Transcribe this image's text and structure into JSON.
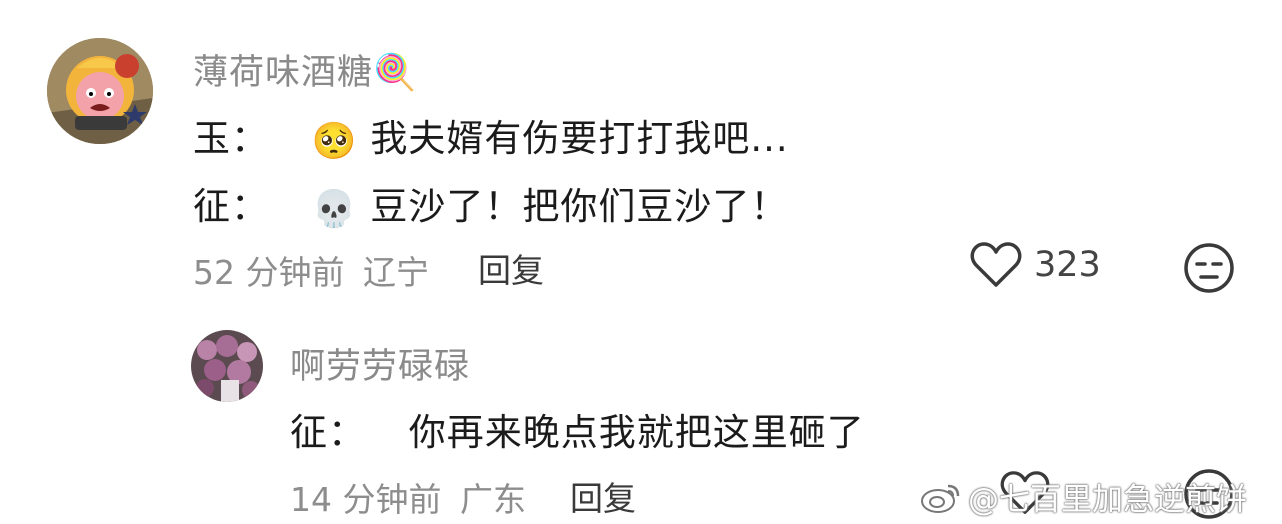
{
  "comments": [
    {
      "username": "薄荷味酒糖🍭",
      "lines": [
        {
          "speaker": "玉：",
          "emoji": "🥺",
          "text": "我夫婿有伤要打打我吧..."
        },
        {
          "speaker": "征：",
          "emoji": "💀",
          "text": "豆沙了！把你们豆沙了！"
        }
      ],
      "time": "52 分钟前",
      "location": "辽宁",
      "reply_label": "回复",
      "like_count": "323"
    },
    {
      "username": "啊劳劳碌碌",
      "lines": [
        {
          "speaker": "征：",
          "text": "你再来晚点我就把这里砸了"
        }
      ],
      "time": "14 分钟前",
      "location": "广东",
      "reply_label": "回复"
    }
  ],
  "watermark": "@七百里加急逆煎饼",
  "colors": {
    "meta": "#8d8d8d",
    "name": "#8a8a8a",
    "text": "#1b1b1b",
    "icon": "#3a3a3a"
  }
}
